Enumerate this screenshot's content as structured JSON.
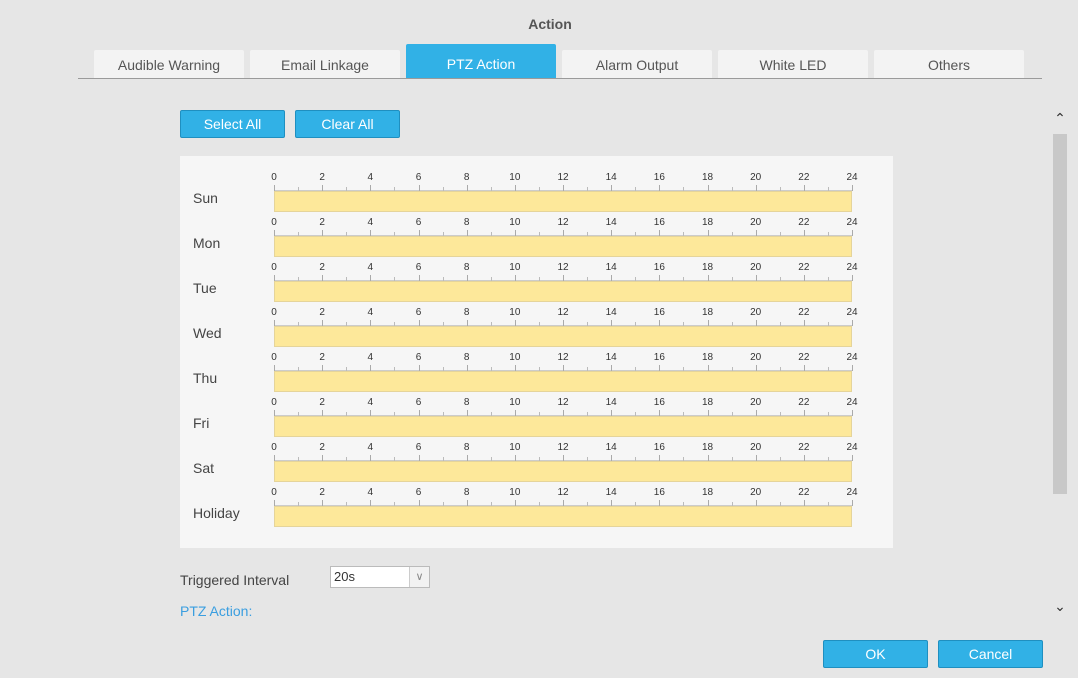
{
  "dialog": {
    "title": "Action"
  },
  "tabs": [
    {
      "label": "Audible Warning",
      "active": false
    },
    {
      "label": "Email Linkage",
      "active": false
    },
    {
      "label": "PTZ Action",
      "active": true
    },
    {
      "label": "Alarm Output",
      "active": false
    },
    {
      "label": "White LED",
      "active": false
    },
    {
      "label": "Others",
      "active": false
    }
  ],
  "toolbar": {
    "select_all": "Select All",
    "clear_all": "Clear All"
  },
  "schedule": {
    "hour_labels": [
      "0",
      "2",
      "4",
      "6",
      "8",
      "10",
      "12",
      "14",
      "16",
      "18",
      "20",
      "22",
      "24"
    ],
    "days": [
      {
        "label": "Sun",
        "selected_fraction": 1
      },
      {
        "label": "Mon",
        "selected_fraction": 1
      },
      {
        "label": "Tue",
        "selected_fraction": 1
      },
      {
        "label": "Wed",
        "selected_fraction": 1
      },
      {
        "label": "Thu",
        "selected_fraction": 1
      },
      {
        "label": "Fri",
        "selected_fraction": 1
      },
      {
        "label": "Sat",
        "selected_fraction": 1
      },
      {
        "label": "Holiday",
        "selected_fraction": 1
      }
    ],
    "bar_color": "#fde89a"
  },
  "triggered_interval": {
    "label": "Triggered Interval",
    "value": "20s"
  },
  "ptz_action": {
    "label": "PTZ Action:"
  },
  "footer": {
    "ok": "OK",
    "cancel": "Cancel"
  },
  "colors": {
    "accent": "#31b1e6",
    "link": "#3a9ee0"
  },
  "icons": {
    "scroll_up": "chevron-up-icon",
    "scroll_down": "chevron-down-icon",
    "dropdown": "chevron-down-icon"
  }
}
